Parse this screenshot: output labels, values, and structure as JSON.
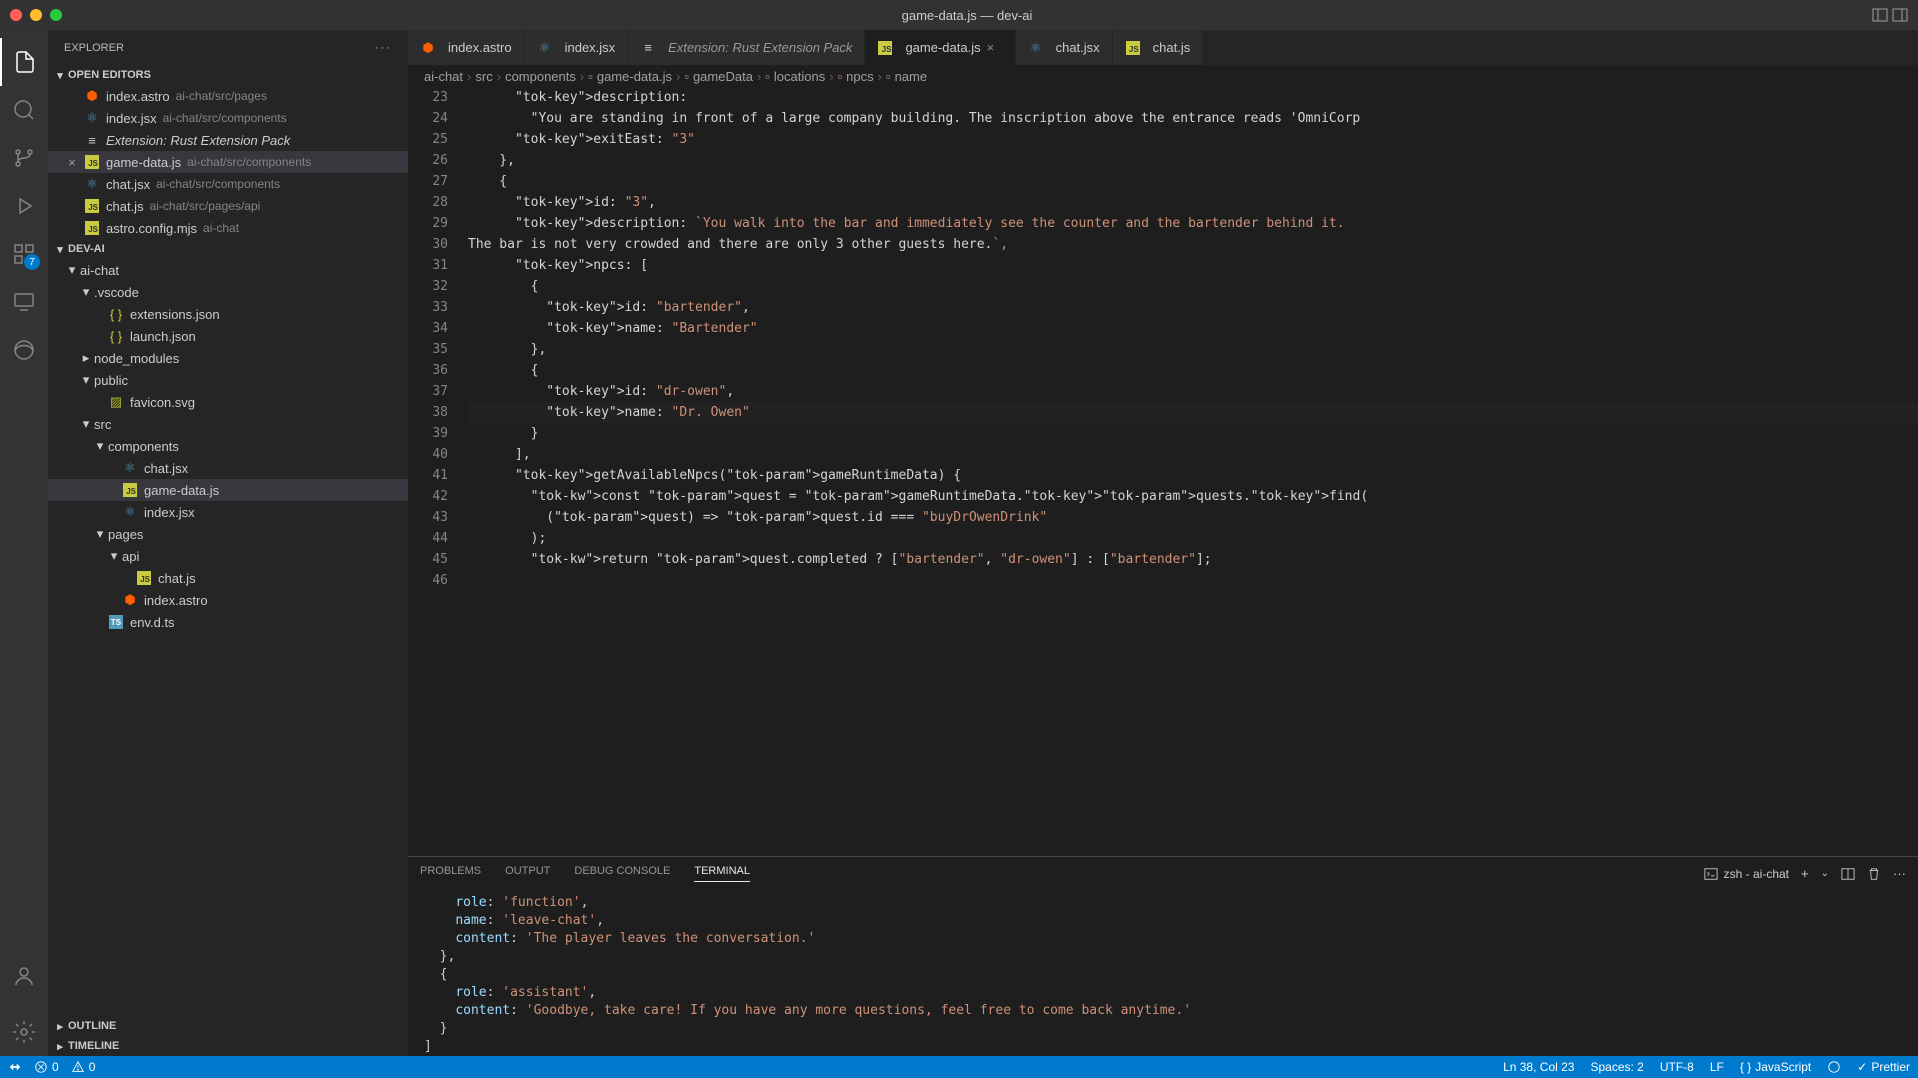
{
  "window": {
    "title": "game-data.js — dev-ai"
  },
  "explorer": {
    "title": "EXPLORER",
    "sections": {
      "openEditors": "OPEN EDITORS",
      "project": "DEV-AI",
      "outline": "OUTLINE",
      "timeline": "TIMELINE"
    },
    "openEditors": [
      {
        "name": "index.astro",
        "path": "ai-chat/src/pages",
        "icon": "astro"
      },
      {
        "name": "index.jsx",
        "path": "ai-chat/src/components",
        "icon": "react"
      },
      {
        "name": "Extension: Rust Extension Pack",
        "path": "",
        "icon": "ext",
        "italic": true
      },
      {
        "name": "game-data.js",
        "path": "ai-chat/src/components",
        "icon": "js",
        "active": true
      },
      {
        "name": "chat.jsx",
        "path": "ai-chat/src/components",
        "icon": "react"
      },
      {
        "name": "chat.js",
        "path": "ai-chat/src/pages/api",
        "icon": "js"
      },
      {
        "name": "astro.config.mjs",
        "path": "ai-chat",
        "icon": "js"
      }
    ],
    "tree": [
      {
        "name": "ai-chat",
        "type": "folder",
        "depth": 0,
        "open": true
      },
      {
        "name": ".vscode",
        "type": "folder",
        "depth": 1,
        "open": true
      },
      {
        "name": "extensions.json",
        "type": "file",
        "depth": 2,
        "icon": "json"
      },
      {
        "name": "launch.json",
        "type": "file",
        "depth": 2,
        "icon": "json"
      },
      {
        "name": "node_modules",
        "type": "folder",
        "depth": 1,
        "open": false
      },
      {
        "name": "public",
        "type": "folder",
        "depth": 1,
        "open": true
      },
      {
        "name": "favicon.svg",
        "type": "file",
        "depth": 2,
        "icon": "svg"
      },
      {
        "name": "src",
        "type": "folder",
        "depth": 1,
        "open": true
      },
      {
        "name": "components",
        "type": "folder",
        "depth": 2,
        "open": true
      },
      {
        "name": "chat.jsx",
        "type": "file",
        "depth": 3,
        "icon": "react"
      },
      {
        "name": "game-data.js",
        "type": "file",
        "depth": 3,
        "icon": "js",
        "selected": true
      },
      {
        "name": "index.jsx",
        "type": "file",
        "depth": 3,
        "icon": "react"
      },
      {
        "name": "pages",
        "type": "folder",
        "depth": 2,
        "open": true
      },
      {
        "name": "api",
        "type": "folder",
        "depth": 3,
        "open": true
      },
      {
        "name": "chat.js",
        "type": "file",
        "depth": 4,
        "icon": "js"
      },
      {
        "name": "index.astro",
        "type": "file",
        "depth": 3,
        "icon": "astro"
      },
      {
        "name": "env.d.ts",
        "type": "file",
        "depth": 2,
        "icon": "ts"
      }
    ]
  },
  "activityBadge": "7",
  "tabs": [
    {
      "label": "index.astro",
      "icon": "astro"
    },
    {
      "label": "index.jsx",
      "icon": "react"
    },
    {
      "label": "Extension: Rust Extension Pack",
      "icon": "ext",
      "italic": true
    },
    {
      "label": "game-data.js",
      "icon": "js",
      "active": true,
      "close": true
    },
    {
      "label": "chat.jsx",
      "icon": "react"
    },
    {
      "label": "chat.js",
      "icon": "js"
    }
  ],
  "breadcrumbs": [
    "ai-chat",
    "src",
    "components",
    "game-data.js",
    "gameData",
    "locations",
    "npcs",
    "name"
  ],
  "code": {
    "startLine": 23,
    "lines": [
      "      description:",
      "        \"You are standing in front of a large company building. The inscription above the entrance reads 'OmniCorp",
      "      exitEast: \"3\"",
      "    },",
      "    {",
      "      id: \"3\",",
      "      description: `You walk into the bar and immediately see the counter and the bartender behind it.",
      "The bar is not very crowded and there are only 3 other guests here.`,",
      "      npcs: [",
      "        {",
      "          id: \"bartender\",",
      "          name: \"Bartender\"",
      "        },",
      "        {",
      "          id: \"dr-owen\",",
      "          name: \"Dr. Owen\"",
      "        }",
      "      ],",
      "      getAvailableNpcs(gameRuntimeData) {",
      "        const quest = gameRuntimeData.quests.find(",
      "          (quest) => quest.id === \"buyDrOwenDrink\"",
      "        );",
      "",
      "        return quest.completed ? [\"bartender\", \"dr-owen\"] : [\"bartender\"];"
    ]
  },
  "panel": {
    "tabs": [
      "PROBLEMS",
      "OUTPUT",
      "DEBUG CONSOLE",
      "TERMINAL"
    ],
    "activeTab": "TERMINAL",
    "terminalLabel": "zsh - ai-chat",
    "terminalLines": [
      "    role: 'function',",
      "    name: 'leave-chat',",
      "    content: 'The player leaves the conversation.'",
      "  },",
      "  {",
      "    role: 'assistant',",
      "    content: 'Goodbye, take care! If you have any more questions, feel free to come back anytime.'",
      "  }",
      "]"
    ]
  },
  "statusbar": {
    "errors": "0",
    "warnings": "0",
    "cursor": "Ln 38, Col 23",
    "spaces": "Spaces: 2",
    "encoding": "UTF-8",
    "eol": "LF",
    "language": "JavaScript",
    "prettier": "Prettier"
  }
}
